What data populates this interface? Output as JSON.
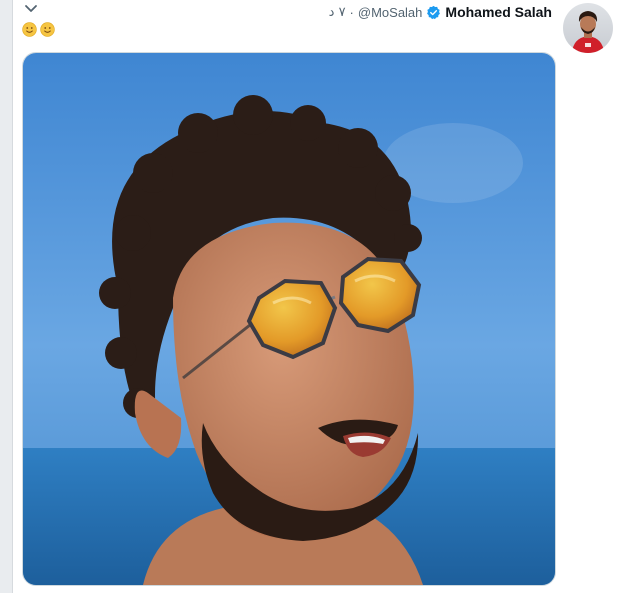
{
  "tweet": {
    "display_name": "Mohamed Salah",
    "handle": "@MoSalah",
    "separator": "·",
    "time": "٧ د",
    "emojis": [
      "slightly-smiling-face",
      "slightly-smiling-face"
    ],
    "icons": {
      "menu": "chevron-down-icon",
      "verified": "verified-badge-icon"
    }
  },
  "colors": {
    "verified": "#1d9bf0",
    "emoji": "#f6c542",
    "sky": "#4a8fd6",
    "sea": "#1f6aa8"
  }
}
